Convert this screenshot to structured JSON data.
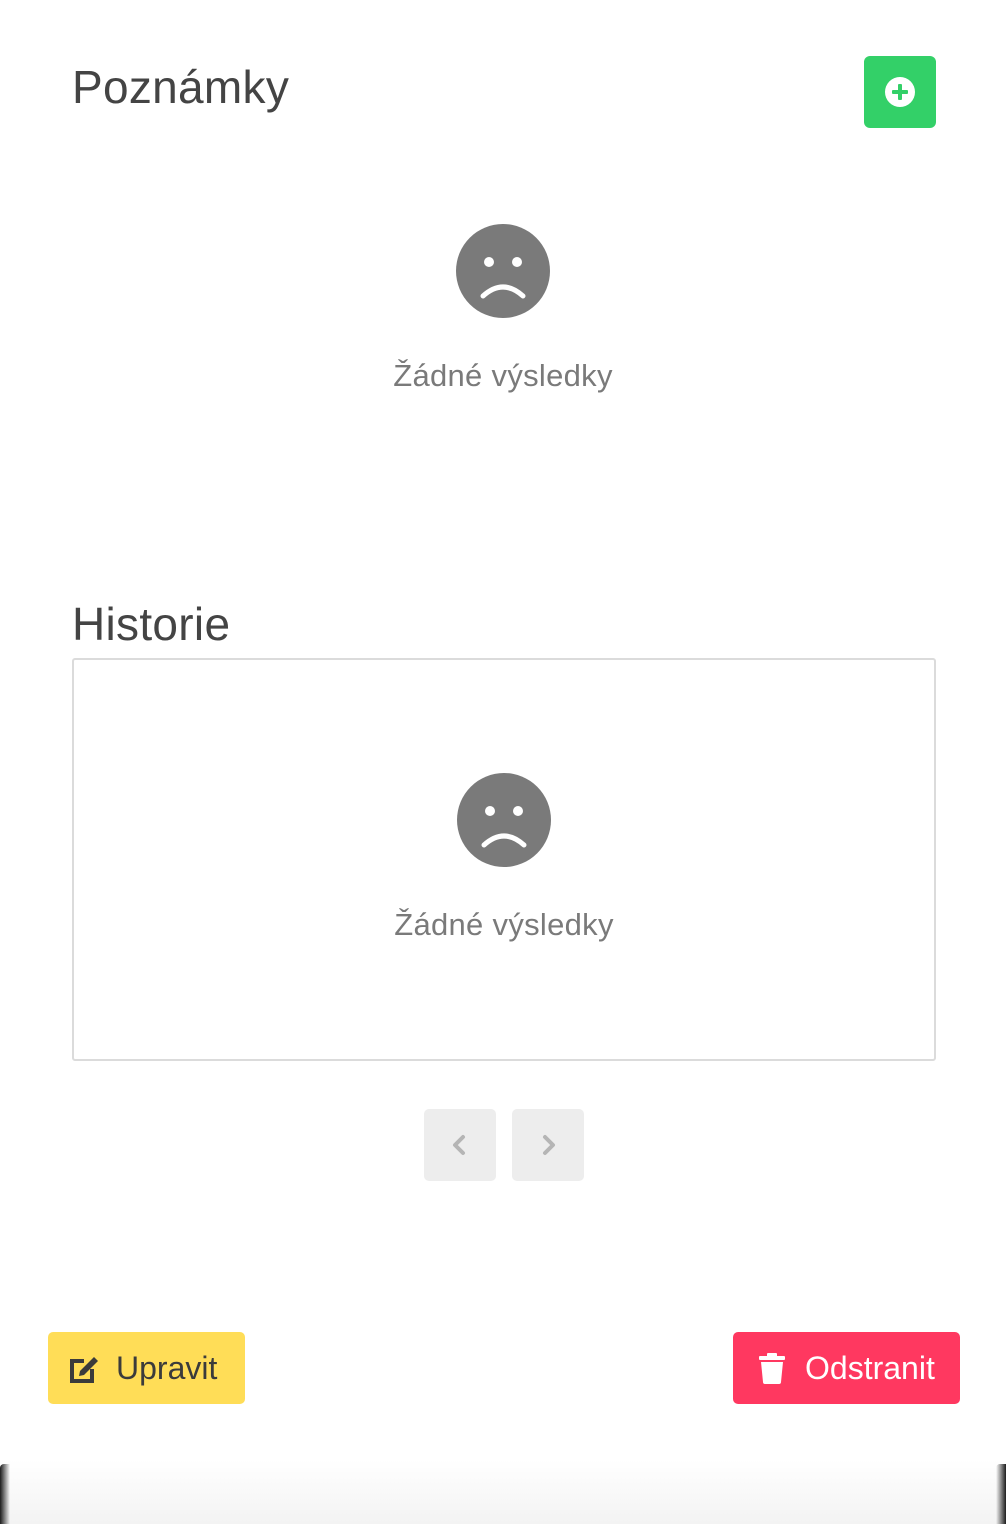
{
  "notes": {
    "title": "Poznámky",
    "add_icon": "plus-circle-icon",
    "empty_icon": "sad-face-icon",
    "empty_text": "Žádné výsledky"
  },
  "history": {
    "title": "Historie",
    "empty_icon": "sad-face-icon",
    "empty_text": "Žádné výsledky",
    "pager": {
      "prev_icon": "chevron-left-icon",
      "next_icon": "chevron-right-icon"
    }
  },
  "actions": {
    "edit_label": "Upravit",
    "edit_icon": "edit-icon",
    "delete_label": "Odstranit",
    "delete_icon": "trash-icon"
  },
  "colors": {
    "add_button": "#33d068",
    "edit_button": "#ffdd57",
    "delete_button": "#ff3860",
    "empty_icon": "#7a7a7a",
    "pager_button": "#ededed"
  }
}
